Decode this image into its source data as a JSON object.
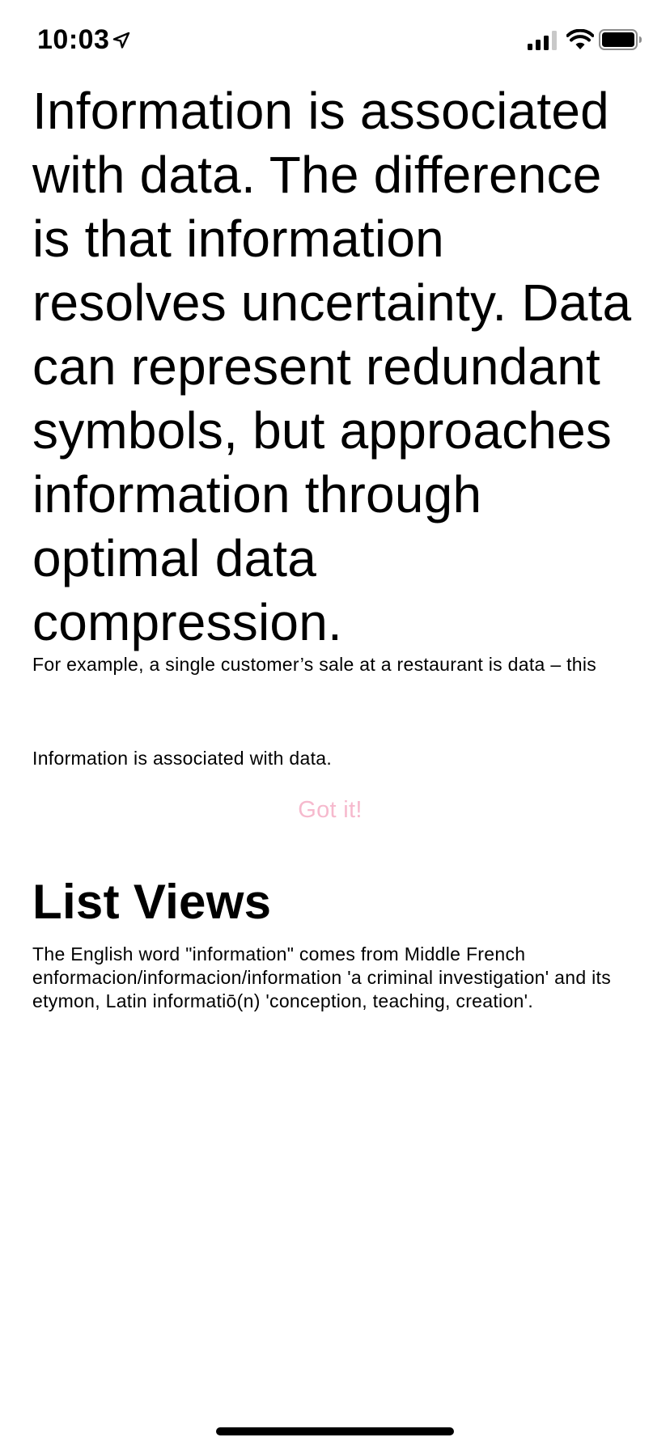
{
  "status_bar": {
    "time": "10:03",
    "icons": [
      "location-arrow-icon",
      "cellular-signal-icon",
      "wifi-icon",
      "battery-icon"
    ]
  },
  "content": {
    "headline": "Information is associated with data. The difference is that information resolves uncertainty. Data can represent redundant symbols, but approaches information through optimal data compression.",
    "example_text": "For example, a single customer’s sale at a restaurant is data – this",
    "info_text": "Information is associated with data.",
    "button_label": "Got it!",
    "section_title": "List Views",
    "section_body": "The English word \"information\" comes from Middle French enformacion/informacion/information 'a criminal investigation' and its etymon, Latin informatiō(n) 'conception, teaching, creation'."
  },
  "colors": {
    "button_text": "#f6b9cd",
    "text": "#000000",
    "background": "#ffffff"
  }
}
